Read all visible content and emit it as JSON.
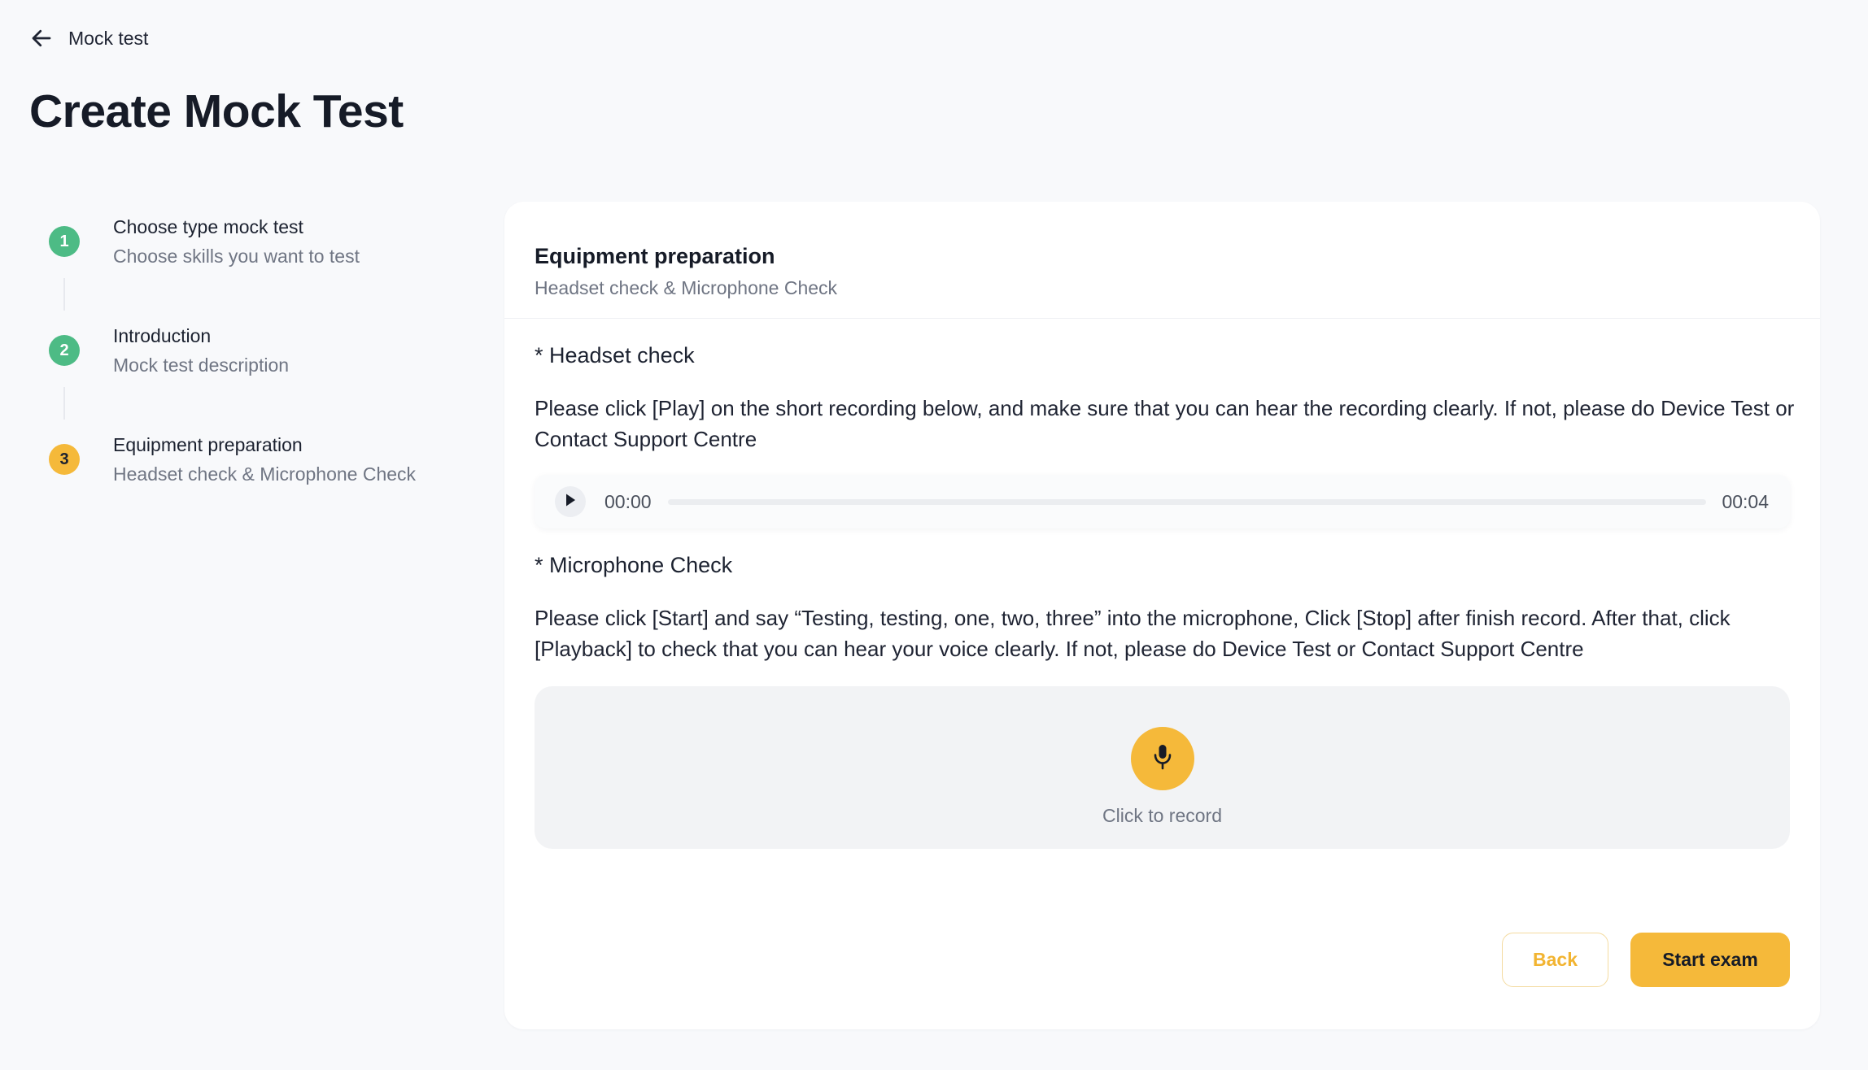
{
  "nav": {
    "back_label": "Mock test"
  },
  "page": {
    "title": "Create Mock Test"
  },
  "stepper": {
    "steps": [
      {
        "number": "1",
        "title": "Choose type mock test",
        "subtitle": "Choose skills you want to test",
        "status": "done"
      },
      {
        "number": "2",
        "title": "Introduction",
        "subtitle": "Mock test description",
        "status": "done"
      },
      {
        "number": "3",
        "title": "Equipment preparation",
        "subtitle": "Headset check & Microphone Check",
        "status": "active"
      }
    ]
  },
  "card": {
    "title": "Equipment preparation",
    "subtitle": "Headset check & Microphone Check",
    "headset": {
      "label": "* Headset check",
      "instructions": "Please click [Play] on the short recording below, and make sure that you can hear the recording clearly. If not, please do Device Test or Contact Support Centre"
    },
    "audio": {
      "current_time": "00:00",
      "duration": "00:04",
      "progress": 0
    },
    "microphone": {
      "label": "* Microphone Check",
      "instructions": "Please click [Start] and say “Testing, testing, one, two, three” into the microphone, Click [Stop] after finish record. After that, click [Playback] to check that you can hear your voice clearly. If not, please do Device Test or Contact Support Centre"
    },
    "record": {
      "label": "Click to record"
    },
    "actions": {
      "back_label": "Back",
      "start_label": "Start exam"
    }
  },
  "colors": {
    "accent": "#f5b93a",
    "done": "#4dbb85",
    "background": "#f8f9fb",
    "card": "#ffffff"
  },
  "icons": {
    "back": "arrow-left-icon",
    "play": "play-icon",
    "microphone": "microphone-icon"
  }
}
